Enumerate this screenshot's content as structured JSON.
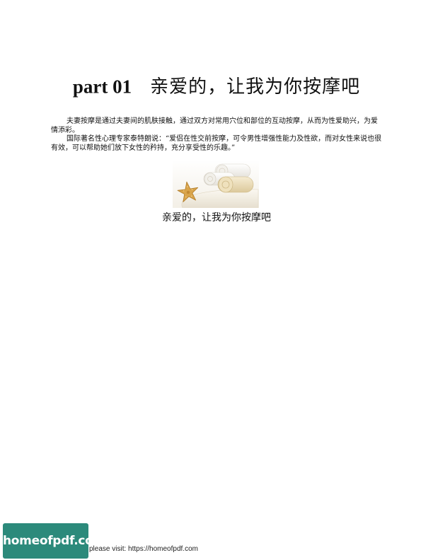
{
  "title": {
    "part": "part 01",
    "main": "亲爱的，让我为你按摩吧"
  },
  "body": {
    "paragraphs": [
      "夫妻按摩是通过夫妻间的肌肤接触，通过双方对常用穴位和部位的互动按摩，从而为性爱助兴，为爱情添彩。",
      "国际著名性心理专家泰特朗说：“爱侣在性交前按摩，可令男性增强性能力及性欲，而对女性来说也很有效，可以帮助她们放下女性的矜持，充分享受性的乐趣。”"
    ]
  },
  "figure": {
    "caption": "亲爱的，让我为你按摩吧"
  },
  "footer": {
    "logo_text": "homeofpdf.com",
    "visit_text": "please visit: https://homeofpdf.com",
    "logo_color": "#2c8a7b"
  }
}
